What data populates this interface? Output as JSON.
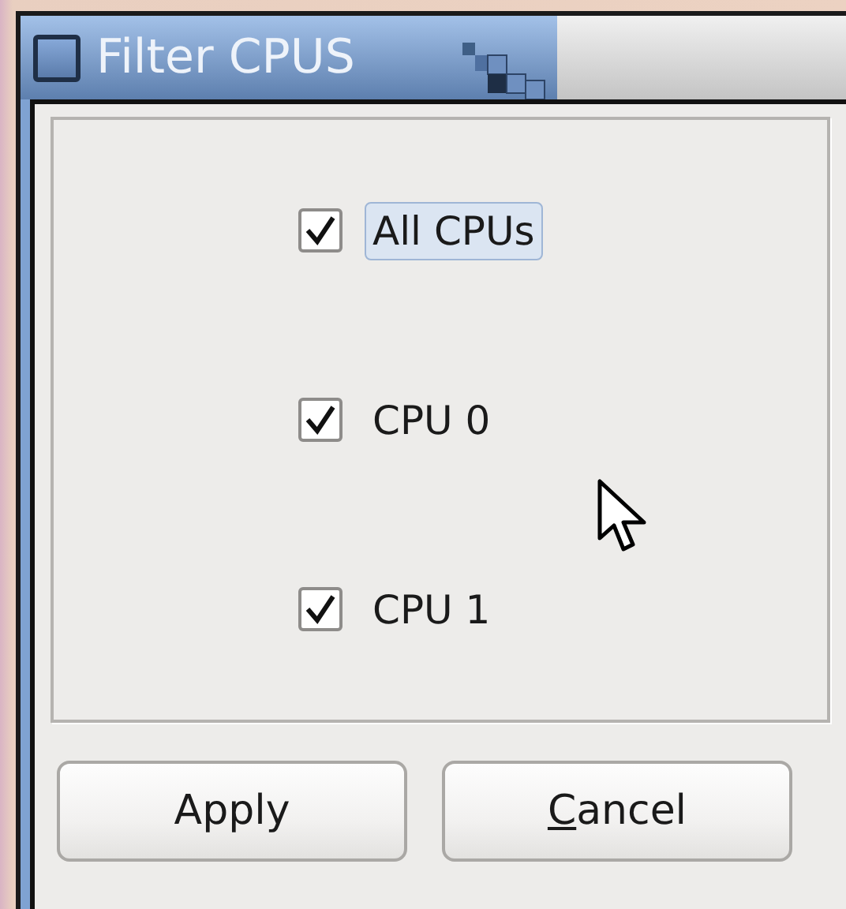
{
  "window": {
    "title": "Filter CPUS"
  },
  "options": [
    {
      "label": "All CPUs",
      "checked": true,
      "focused": true
    },
    {
      "label": "CPU 0",
      "checked": true,
      "focused": false
    },
    {
      "label": "CPU 1",
      "checked": true,
      "focused": false
    }
  ],
  "buttons": [
    {
      "label": "Apply",
      "first_letter_underlined": false
    },
    {
      "label": "Cancel",
      "first_letter_underlined": true
    }
  ]
}
